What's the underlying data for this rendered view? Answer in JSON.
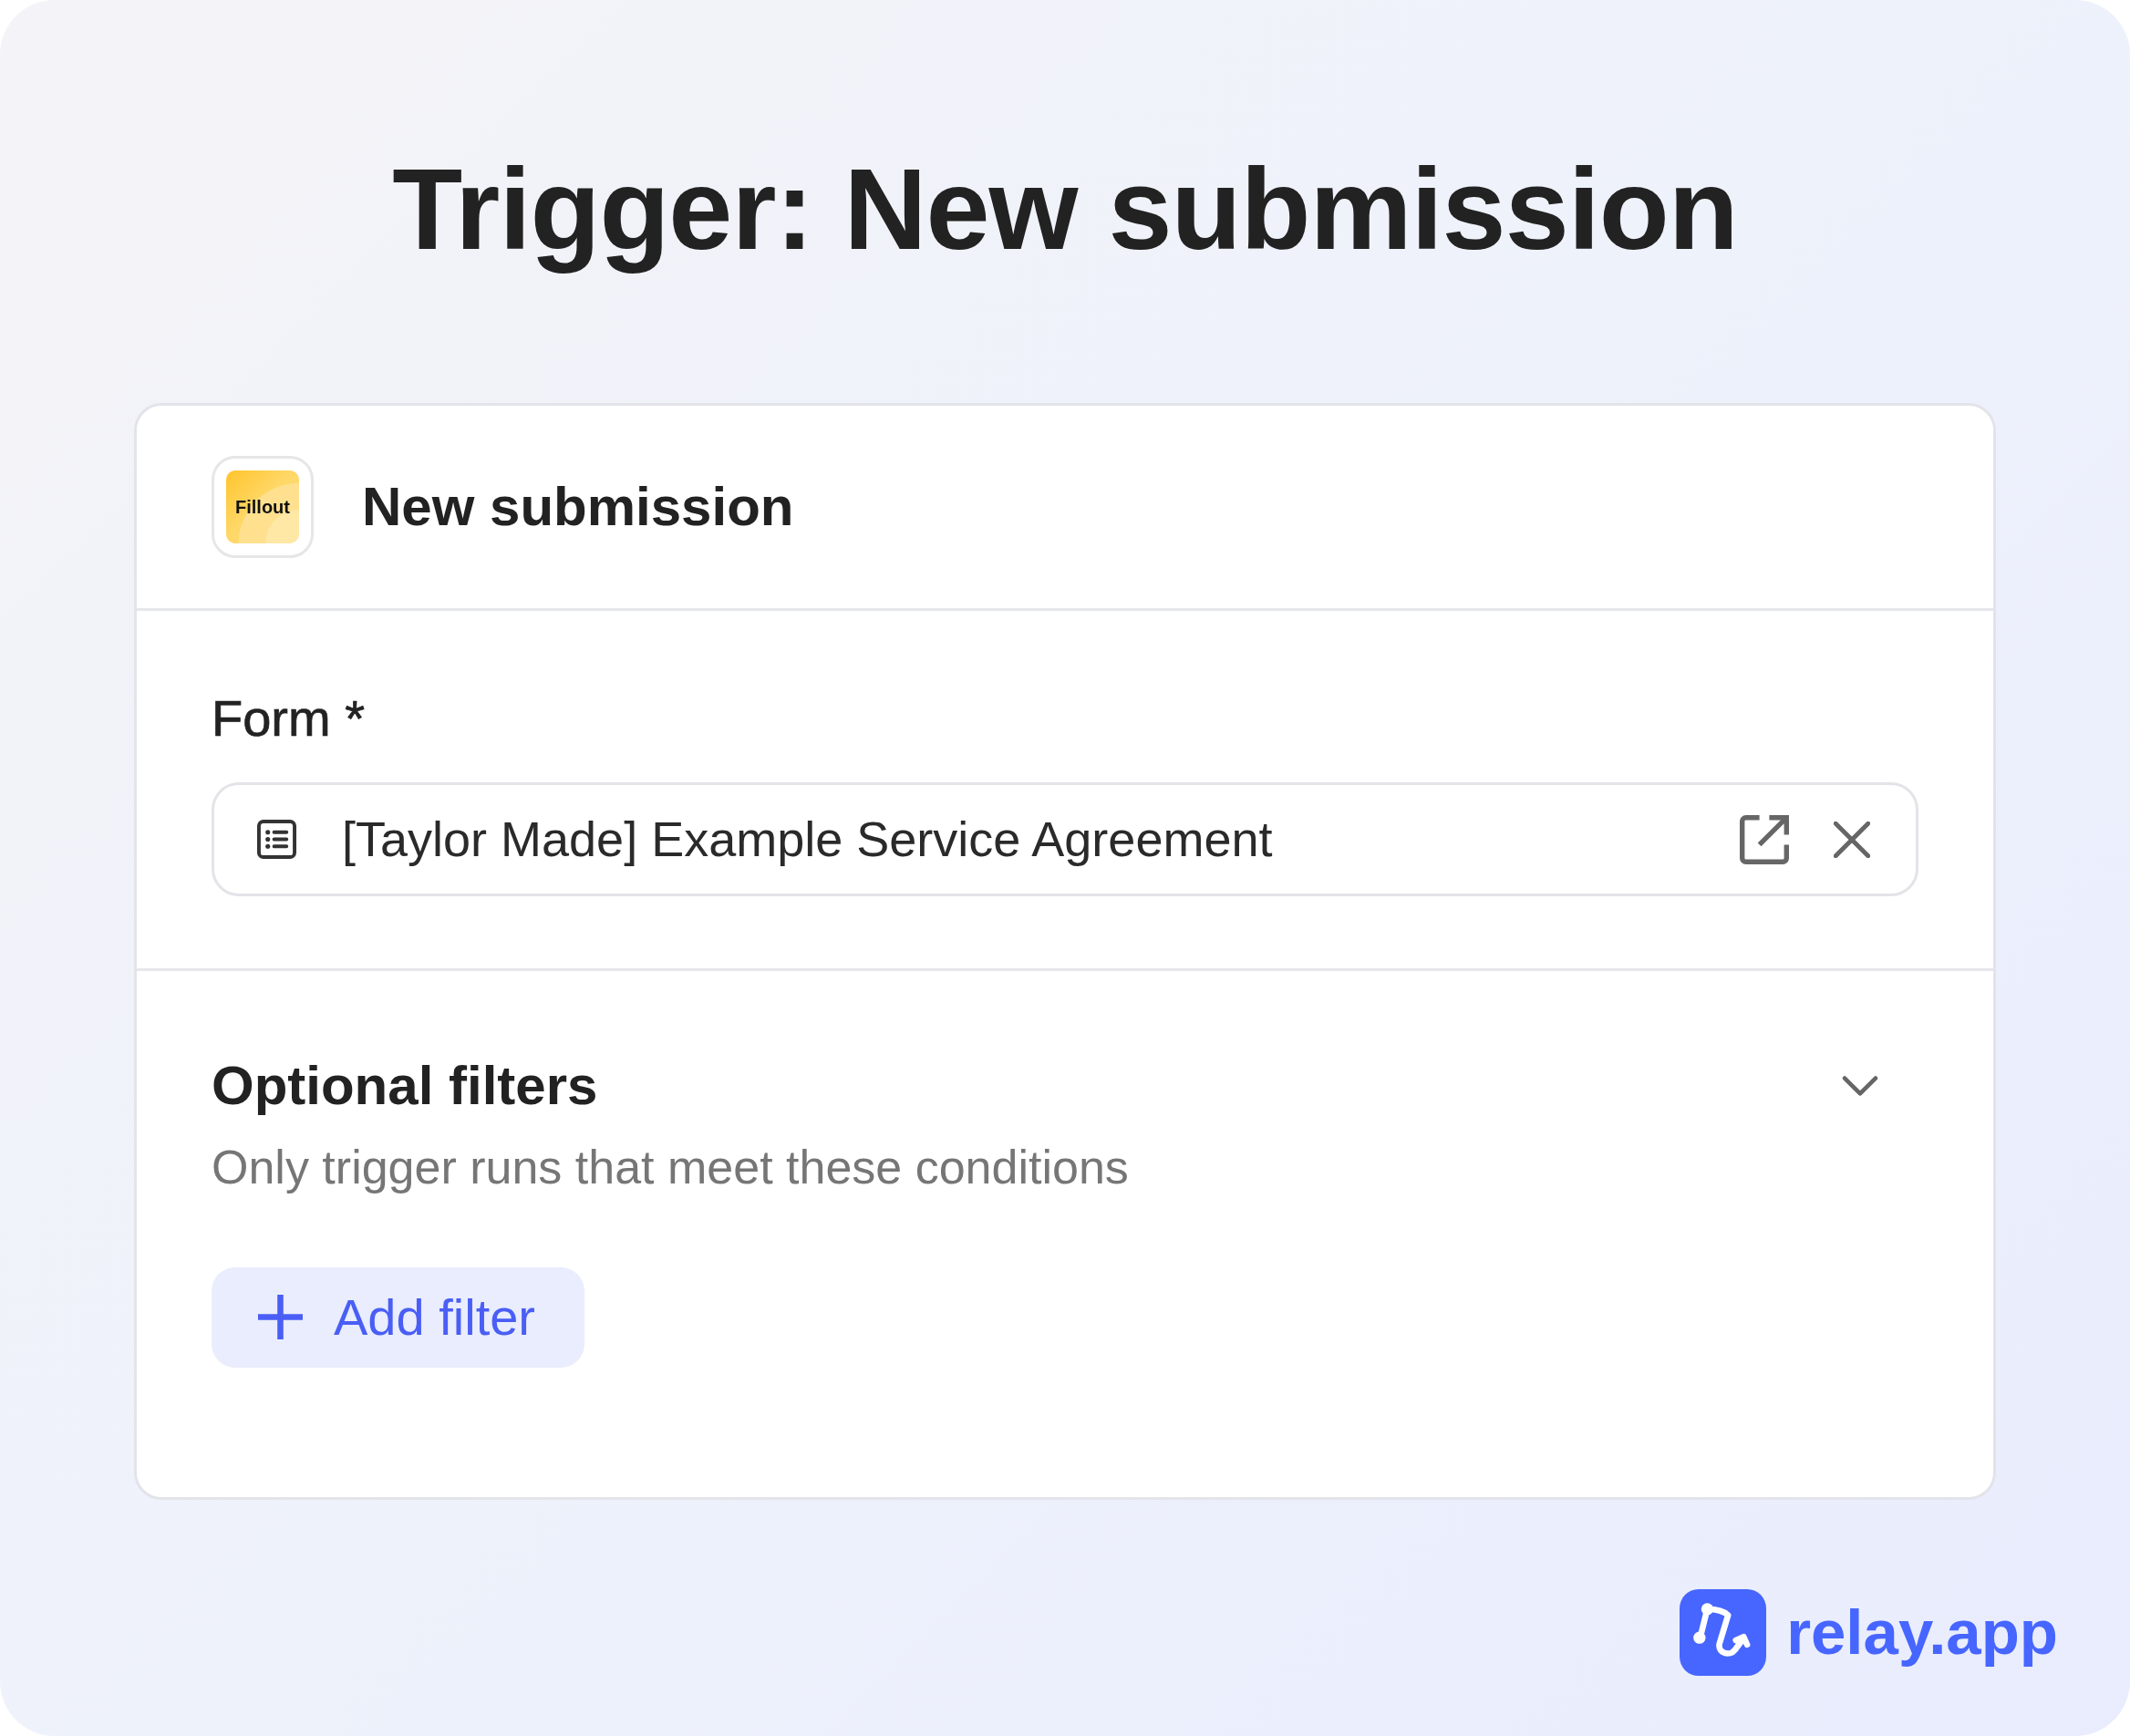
{
  "heading": "Trigger: New submission",
  "step": {
    "app_logo": "Fillout",
    "title": "New submission"
  },
  "form_field": {
    "label": "Form *",
    "value": "[Taylor Made] Example Service Agreement"
  },
  "filters": {
    "title": "Optional filters",
    "description": "Only trigger runs that meet these conditions",
    "add_button": "Add filter"
  },
  "brand": {
    "name": "relay.app"
  }
}
